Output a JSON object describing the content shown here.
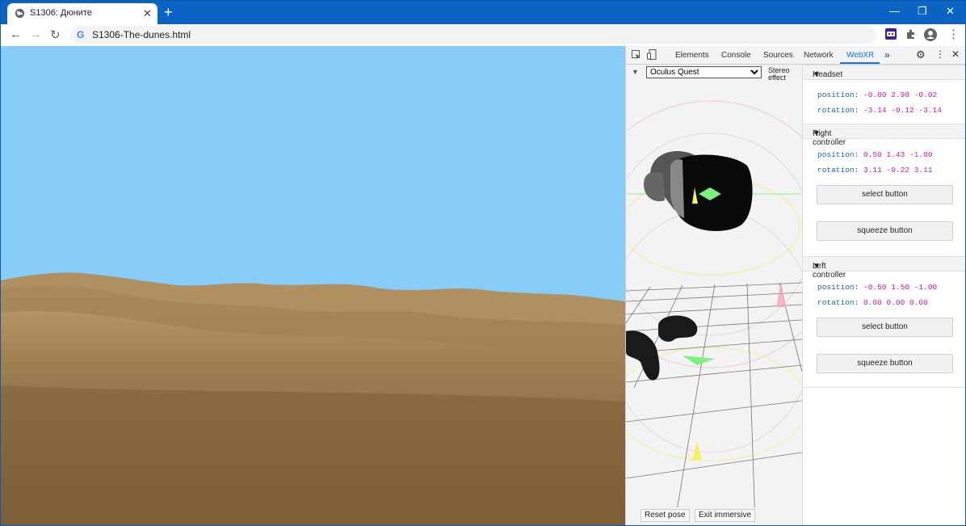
{
  "browser": {
    "tab_title": "S1306: Дюните",
    "new_tab_symbol": "+",
    "url": "S1306-The-dunes.html",
    "minimize": "—",
    "restore": "❐",
    "close": "✕"
  },
  "devtools": {
    "tabs": [
      "Elements",
      "Console",
      "Sources",
      "Network",
      "WebXR"
    ],
    "more": "»",
    "active_tab": "WebXR",
    "device_select": "Oculus Quest",
    "stereo_label": "Stereo effect",
    "reset_pose": "Reset pose",
    "exit_immersive": "Exit immersive"
  },
  "webxr": {
    "headset": {
      "title": "Headset",
      "position_label": "position:",
      "position": "-0.00 2.98 -0.02",
      "rotation_label": "rotation:",
      "rotation": "-3.14 -0.12 -3.14"
    },
    "right_controller": {
      "title": "Right controller",
      "position_label": "position:",
      "position": "0.50 1.43 -1.00",
      "rotation_label": "rotation:",
      "rotation": "3.11 -0.22 3.11",
      "select_button": "select button",
      "squeeze_button": "squeeze button"
    },
    "left_controller": {
      "title": "Left controller",
      "position_label": "position:",
      "position": "-0.50 1.50 -1.00",
      "rotation_label": "rotation:",
      "rotation": "0.00 0.00 0.00",
      "select_button": "select button",
      "squeeze_button": "squeeze button"
    }
  },
  "colors": {
    "sky": "#86cdf9",
    "sand": "#8f7046",
    "chrome_blue": "#0b63c4"
  }
}
